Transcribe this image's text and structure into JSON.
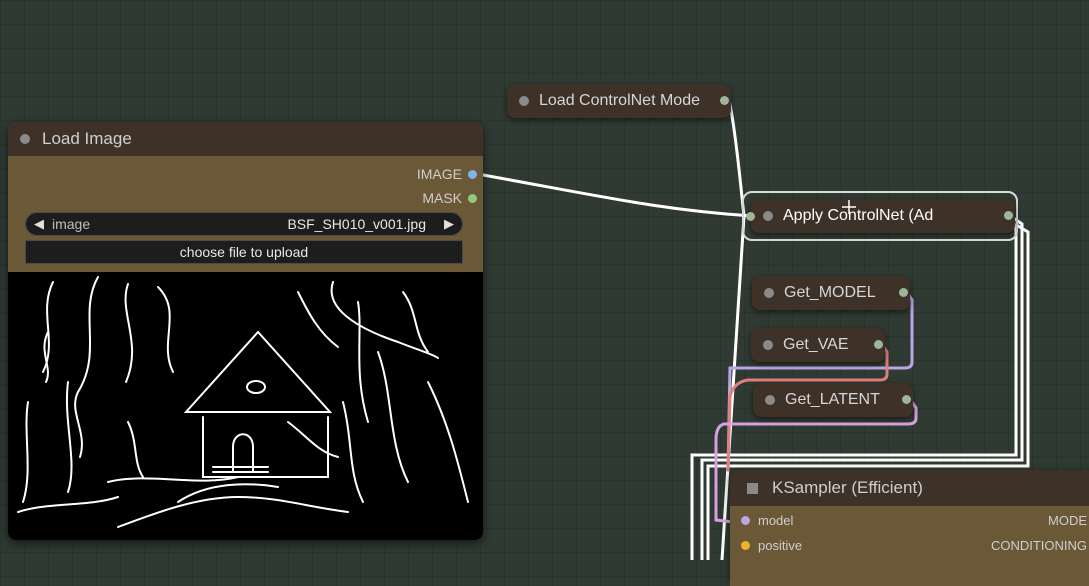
{
  "load_controlnet": {
    "title": "Load ControlNet Mode"
  },
  "load_image": {
    "title": "Load Image",
    "outputs": {
      "image": "IMAGE",
      "mask": "MASK"
    },
    "image_widget": {
      "label": "image",
      "value": "BSF_SH010_v001.jpg"
    },
    "upload_label": "choose file to upload"
  },
  "apply_controlnet": {
    "title": "Apply ControlNet (Ad"
  },
  "get_nodes": {
    "model": "Get_MODEL",
    "vae": "Get_VAE",
    "latent": "Get_LATENT"
  },
  "ksampler": {
    "title": "KSampler (Efficient)",
    "inputs": {
      "model": "model",
      "positive": "positive"
    },
    "outputs": {
      "model": "MODE",
      "conditioning": "CONDITIONING"
    }
  },
  "colors": {
    "canvas": "#2f3a33",
    "node_title": "#3d3128",
    "node_body": "#6b5836",
    "image_port": "#7fb3e8",
    "mask_port": "#93c97f",
    "model_wire": "#b8a6e6",
    "vae_wire": "#e27d7d",
    "latent_wire": "#d8a0e0",
    "positive_port": "#f0b030"
  }
}
